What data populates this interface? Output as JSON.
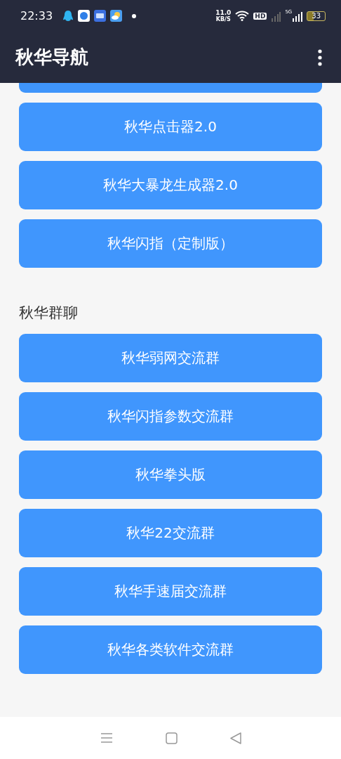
{
  "status_bar": {
    "time": "22:33",
    "speed": "11.0",
    "speed_unit": "KB/S",
    "hd": "HD",
    "network": "5G",
    "battery": "33"
  },
  "app_bar": {
    "title": "秋华导航"
  },
  "sections": [
    {
      "buttons": [
        "秋华点击器2.0",
        "秋华大暴龙生成器2.0",
        "秋华闪指（定制版）"
      ]
    },
    {
      "heading": "秋华群聊",
      "buttons": [
        "秋华弱网交流群",
        "秋华闪指参数交流群",
        "秋华拳头版",
        "秋华22交流群",
        "秋华手速届交流群",
        "秋华各类软件交流群"
      ]
    }
  ]
}
